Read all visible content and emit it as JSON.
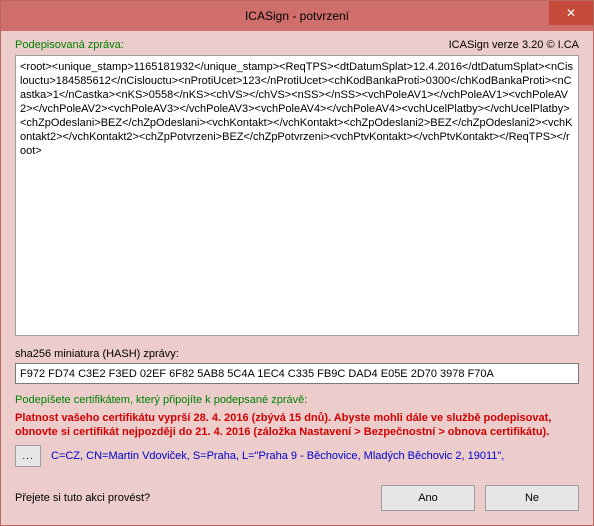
{
  "window": {
    "title": "ICASign - potvrzení",
    "close": "✕"
  },
  "header": {
    "signed_msg_label": "Podepisovaná zpráva:",
    "version": "ICASign verze 3.20 © I.CA"
  },
  "message_xml": "<root><unique_stamp>1165181932</unique_stamp><ReqTPS><dtDatumSplat>12.4.2016</dtDatumSplat><nCislouctu>184585612</nCislouctu><nProtiUcet>123</nProtiUcet><chKodBankaProti>0300</chKodBankaProti><nCastka>1</nCastka><nKS>0558</nKS><chVS></chVS><nSS></nSS><vchPoleAV1></vchPoleAV1><vchPoleAV2></vchPoleAV2><vchPoleAV3></vchPoleAV3><vchPoleAV4></vchPoleAV4><vchUcelPlatby></vchUcelPlatby><chZpOdeslani>BEZ</chZpOdeslani><vchKontakt></vchKontakt><chZpOdeslani2>BEZ</chZpOdeslani2><vchKontakt2></vchKontakt2><chZpPotvrzeni>BEZ</chZpPotvrzeni><vchPtvKontakt></vchPtvKontakt></ReqTPS></root>",
  "hash": {
    "label": "sha256 miniatura (HASH) zprávy:",
    "value": "F972 FD74 C3E2 F3ED 02EF 6F82 5AB8 5C4A 1EC4 C335 FB9C DAD4 E05E 2D70 3978 F70A"
  },
  "cert": {
    "intro": "Podepíšete certifikátem, který připojíte k podepsané zprávě:",
    "warning": "Platnost vašeho certifikátu vyprší 28. 4. 2016 (zbývá 15 dnů). Abyste mohli dále ve službě podepisovat, obnovte si certifikát nejpozději do 21. 4. 2016 (záložka Nastavení > Bezpečnostní > obnova certifikátu).",
    "browse_label": "...",
    "dn": "C=CZ, CN=Martin Vdoviček, S=Praha, L=\"Praha 9 - Běchovice, Mladých Běchovic 2, 19011\","
  },
  "confirm": {
    "question": "Přejete si tuto akci provést?",
    "yes": "Ano",
    "no": "Ne"
  }
}
